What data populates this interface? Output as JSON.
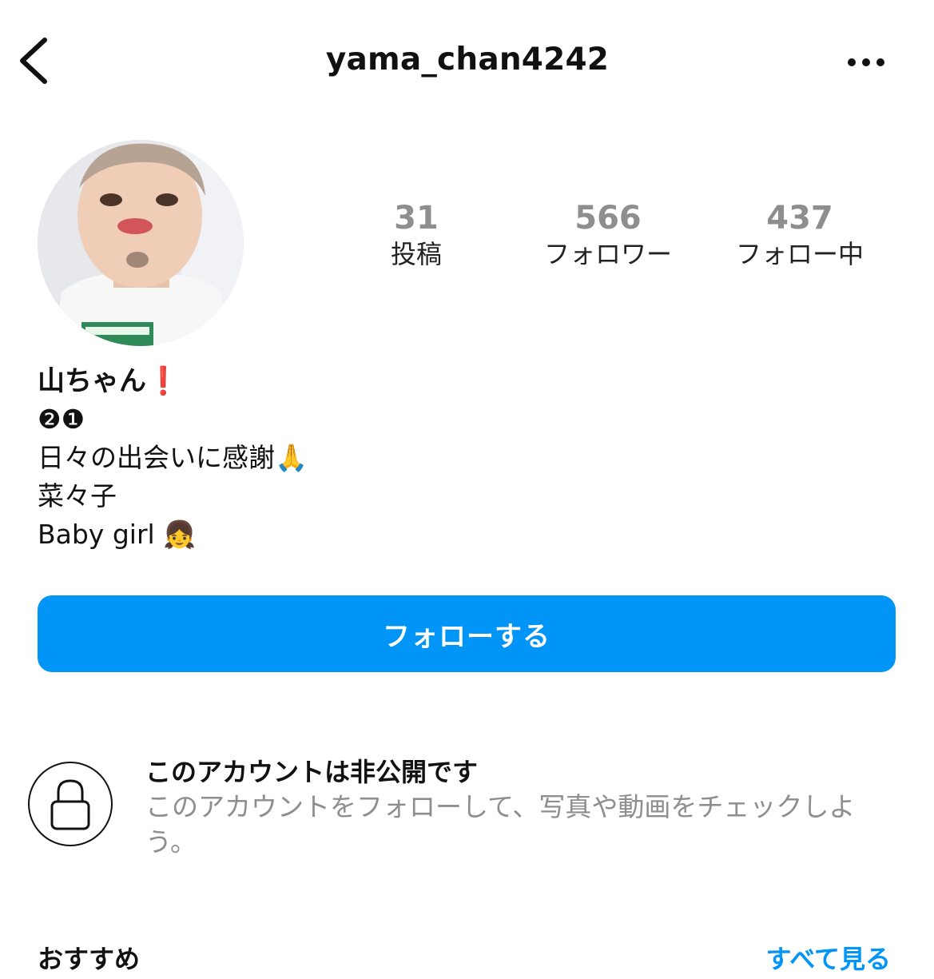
{
  "header": {
    "username": "yama_chan4242",
    "back_icon": "chevron-left-icon",
    "more_icon": "more-horizontal-icon"
  },
  "profile": {
    "avatar": "profile-avatar",
    "stats": [
      {
        "value": "31",
        "label": "投稿"
      },
      {
        "value": "566",
        "label": "フォロワー"
      },
      {
        "value": "437",
        "label": "フォロー中"
      }
    ],
    "display_name": "山ちゃん",
    "display_name_emoji": "❗",
    "bio": {
      "line1": "❷❶",
      "line2": "日々の出会いに感謝",
      "line2_emoji": "🙏",
      "line3": "菜々子",
      "line4": "Baby girl",
      "line4_emoji": "👧"
    }
  },
  "follow_button": {
    "label": "フォローする"
  },
  "private_notice": {
    "icon": "lock-icon",
    "title": "このアカウントは非公開です",
    "description": "このアカウントをフォローして、写真や動画をチェックしよう。"
  },
  "recommendations": {
    "title": "おすすめ",
    "see_all": "すべて見る"
  },
  "colors": {
    "accent": "#0095f6",
    "secondary_text": "#8e8e8e",
    "primary_text": "#111111"
  }
}
